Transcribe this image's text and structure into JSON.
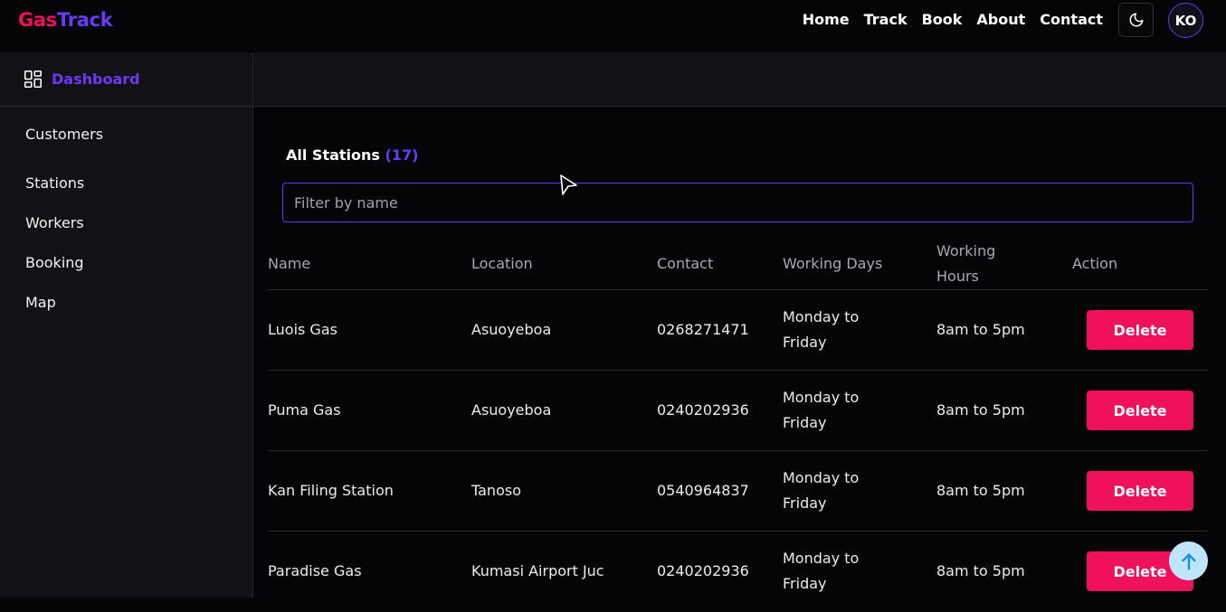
{
  "logo": {
    "part1": "Gas",
    "part2": "Track"
  },
  "nav": [
    "Home",
    "Track",
    "Book",
    "About",
    "Contact"
  ],
  "avatar_initials": "KO",
  "sidebar": {
    "header": "Dashboard",
    "items": [
      "Customers",
      "Stations",
      "Workers",
      "Booking",
      "Map"
    ]
  },
  "main": {
    "title": "All Stations",
    "count": "(17)",
    "filter_placeholder": "Filter by name",
    "columns": {
      "name": "Name",
      "location": "Location",
      "contact": "Contact",
      "days": "Working Days",
      "hours_line1": "Working",
      "hours_line2": "Hours",
      "action": "Action"
    },
    "rows": [
      {
        "name": "Luois Gas",
        "location": "Asuoyeboa",
        "contact": "0268271471",
        "days_line1": "Monday to",
        "days_line2": "Friday",
        "hours": "8am to 5pm",
        "action": "Delete"
      },
      {
        "name": "Puma Gas",
        "location": "Asuoyeboa",
        "contact": "0240202936",
        "days_line1": "Monday to",
        "days_line2": "Friday",
        "hours": "8am to 5pm",
        "action": "Delete"
      },
      {
        "name": "Kan Filing Station",
        "location": "Tanoso",
        "contact": "0540964837",
        "days_line1": "Monday to",
        "days_line2": "Friday",
        "hours": "8am to 5pm",
        "action": "Delete"
      },
      {
        "name": "Paradise Gas",
        "location": "Kumasi Airport Juc",
        "contact": "0240202936",
        "days_line1": "Monday to",
        "days_line2": "Friday",
        "hours": "8am to 5pm",
        "action": "Delete"
      }
    ]
  },
  "icons": {
    "theme": "moon-icon",
    "dashboard": "grid-icon",
    "scroll": "arrow-up-icon"
  },
  "colors": {
    "accent": "#6a3bf5",
    "brand_pink": "#f0115c",
    "background": "#050508",
    "sidebar": "#121216"
  }
}
